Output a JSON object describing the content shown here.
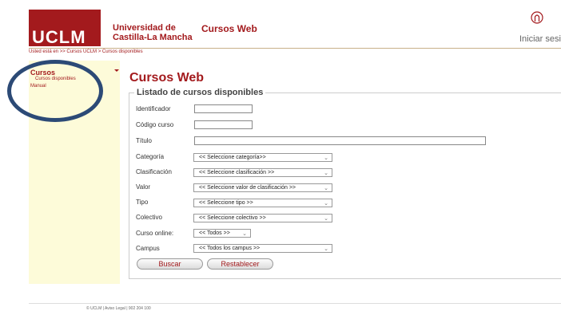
{
  "header": {
    "logo_text": "UCLM",
    "university_line1": "Universidad de",
    "university_line2": "Castilla-La Mancha",
    "app_title": "Cursos Web",
    "login_label": "Iniciar sesión"
  },
  "breadcrumb": "Usted está en >> Cursos UCLM > Cursos disponibles",
  "sidebar": {
    "title": "Cursos",
    "items": [
      {
        "label": "Cursos disponibles"
      },
      {
        "label": "Manual"
      }
    ]
  },
  "main": {
    "title": "Cursos Web",
    "legend": "Listado de cursos disponibles",
    "fields": {
      "identificador": {
        "label": "Identificador",
        "value": ""
      },
      "codigo": {
        "label": "Código curso",
        "value": ""
      },
      "titulo": {
        "label": "Título",
        "value": ""
      },
      "categoria": {
        "label": "Categoría",
        "selected": "<< Seleccione categoría>>"
      },
      "clasificacion": {
        "label": "Clasificación",
        "selected": "<< Seleccione clasificación >>"
      },
      "valor": {
        "label": "Valor",
        "selected": "<< Seleccione valor de clasificación >>"
      },
      "tipo": {
        "label": "Tipo",
        "selected": "<< Seleccione tipo >>"
      },
      "colectivo": {
        "label": "Colectivo",
        "selected": "<< Seleccione colectivo >>"
      },
      "online": {
        "label": "Curso online:",
        "selected": "<< Todos >>"
      },
      "campus": {
        "label": "Campus",
        "selected": "<< Todos los campus >>"
      }
    },
    "buttons": {
      "search": "Buscar",
      "reset": "Restablecer"
    }
  },
  "footer": "© UCLM | Aviso Legal | 902 204 100",
  "colors": {
    "brand": "#a31a1d",
    "sidebar_bg": "#fdfbd9",
    "highlight_circle": "#2c4a76"
  }
}
